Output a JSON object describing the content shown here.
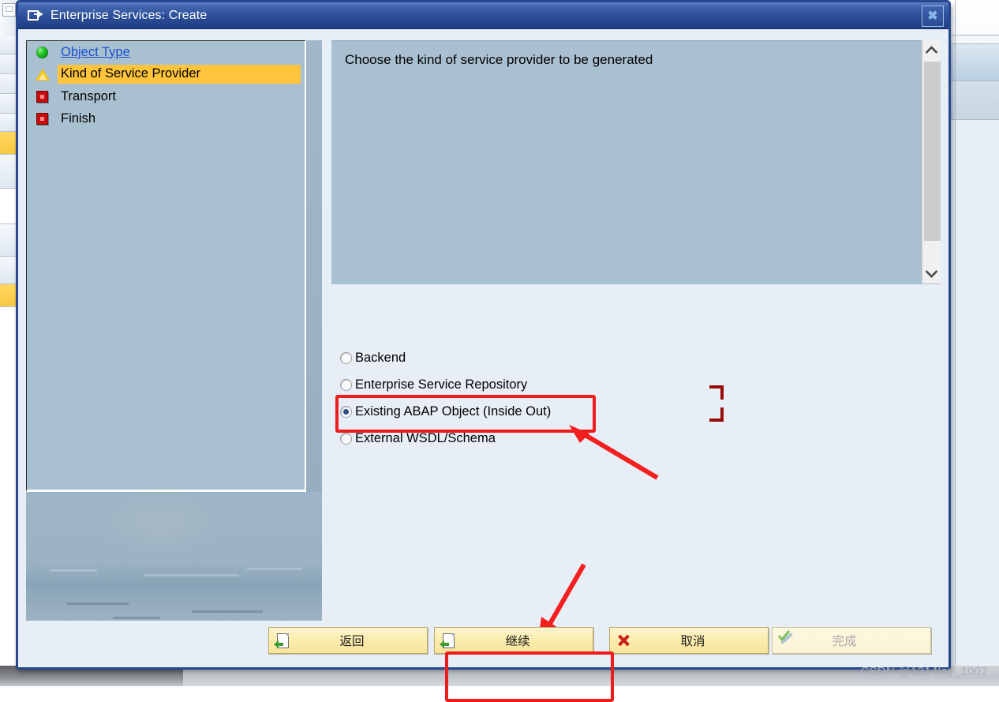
{
  "window": {
    "title": "Enterprise Services: Create",
    "title_icon": "window-create-icon",
    "close_label": "✖"
  },
  "steps": [
    {
      "label": "Object Type",
      "status": "complete",
      "icon": "green-sphere-icon",
      "state": "link"
    },
    {
      "label": "Kind of Service Provider",
      "status": "current",
      "icon": "yellow-triangle-warning-icon",
      "state": "current"
    },
    {
      "label": "Transport",
      "status": "pending",
      "icon": "red-square-icon",
      "state": "normal"
    },
    {
      "label": "Finish",
      "status": "pending",
      "icon": "red-square-icon",
      "state": "normal"
    }
  ],
  "content": {
    "heading": "Choose the kind of service provider to be generated"
  },
  "scrollbar": {
    "up_icon": "chevron-up-icon",
    "down_icon": "chevron-down-icon",
    "thumb_name": "scrollbar-thumb"
  },
  "radio_group": {
    "name": "kind-of-service-provider",
    "options": [
      {
        "label": "Backend",
        "selected": false
      },
      {
        "label": "Enterprise Service Repository",
        "selected": false
      },
      {
        "label": "Existing ABAP Object (Inside Out)",
        "selected": true
      },
      {
        "label": "External WSDL/Schema",
        "selected": false
      }
    ]
  },
  "buttons": [
    {
      "label": "返回",
      "icon": "page-back-icon",
      "enabled": true,
      "name": "back-button"
    },
    {
      "label": "继续",
      "icon": "page-continue-icon",
      "enabled": true,
      "name": "continue-button"
    },
    {
      "label": "取消",
      "icon": "red-x-icon",
      "enabled": true,
      "name": "cancel-button"
    },
    {
      "label": "完成",
      "icon": "check-pencil-icon",
      "enabled": false,
      "name": "finish-button"
    }
  ],
  "annotations": {
    "highlight_color": "#ee1c1c",
    "corner_color": "#990a0a",
    "radio_box_target": "Existing ABAP Object (Inside Out)",
    "button_box_target": "继续"
  },
  "watermark": {
    "text": "CSDN @1314lay_1007"
  }
}
